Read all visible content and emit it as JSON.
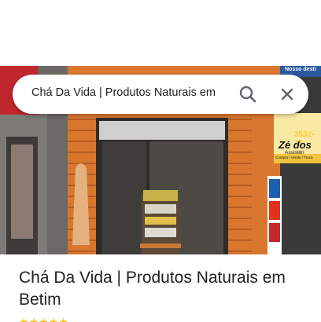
{
  "search": {
    "query": "Chá Da Vida | Produtos Naturais em"
  },
  "place": {
    "title": "Chá Da Vida | Produtos Naturais em Betim",
    "rating_stars": 5
  },
  "photo": {
    "sign_text_top": "Nosso desti",
    "phone_partial": "3532-19",
    "shop_sign": "Zé dos",
    "shop_sign_sub": "Assistên",
    "shop_sign_tagline": "Compra / Venda / Troca"
  },
  "colors": {
    "search_icon": "#5f6368",
    "title_text": "#202124",
    "stars": "#fbbc04"
  }
}
